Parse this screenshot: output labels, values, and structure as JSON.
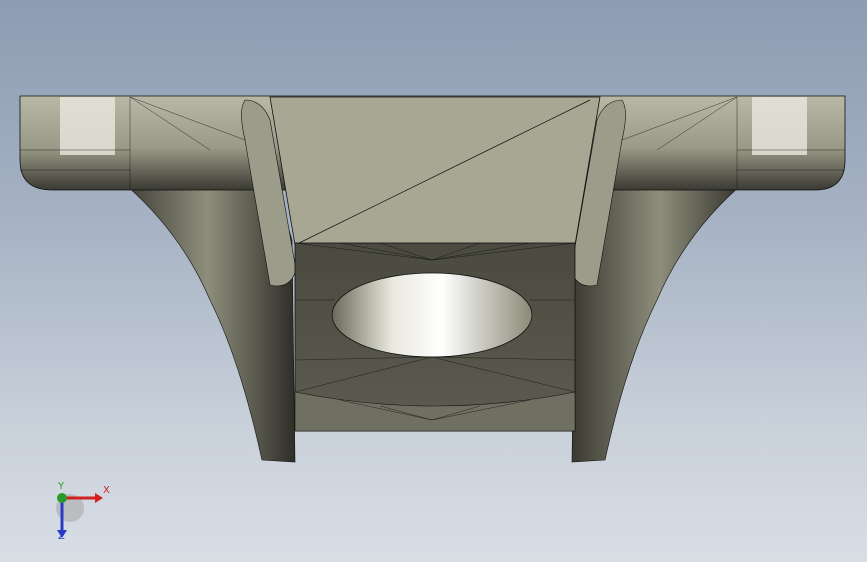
{
  "view": {
    "background_top": "#8d9cb3",
    "background_bottom": "#d9dee5",
    "model_fill": "#a8a895",
    "model_shadow": "#4a4a40",
    "mesh_line": "#111111"
  },
  "triad": {
    "x_label": "X",
    "y_label": "Y",
    "z_label": "Z",
    "x_color": "#d32020",
    "y_color": "#2a9a2a",
    "z_color": "#2a3ac8"
  }
}
